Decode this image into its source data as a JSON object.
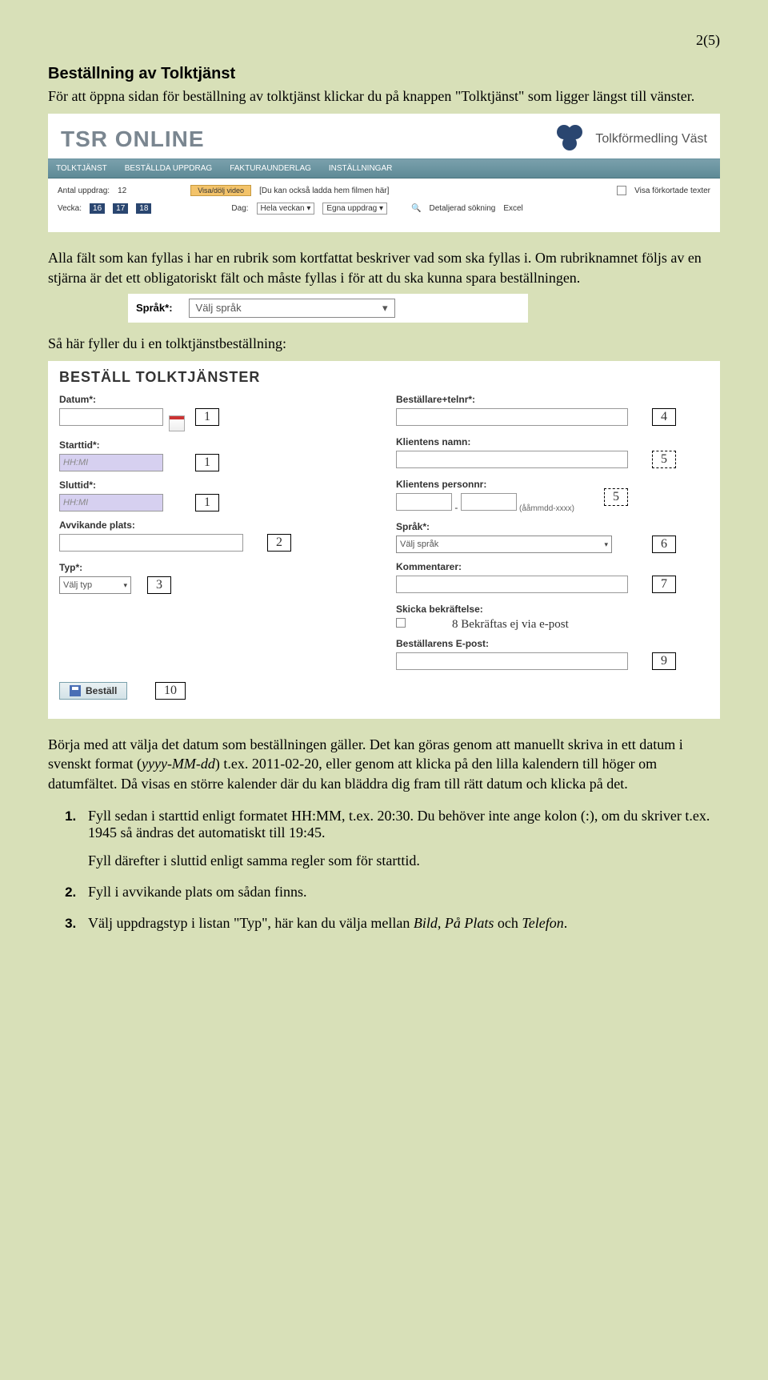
{
  "page_number": "2(5)",
  "heading": "Beställning av Tolktjänst",
  "intro": "För att öppna sidan för beställning av tolktjänst klickar du på knappen \"Tolktjänst\" som ligger längst till vänster.",
  "tsr": {
    "title": "TSR ONLINE",
    "logo_text": "Tolkförmedling Väst",
    "nav": [
      "TOLKTJÄNST",
      "BESTÄLLDA UPPDRAG",
      "FAKTURAUNDERLAG",
      "INSTÄLLNINGAR"
    ],
    "row1": {
      "antal_label": "Antal uppdrag:",
      "antal_val": "12",
      "visa_dolj": "Visa/dölj video",
      "film_text": "[Du kan också ladda hem filmen här]",
      "forkortade": "Visa förkortade texter"
    },
    "row2": {
      "vecka": "Vecka:",
      "days": [
        "16",
        "17",
        "18"
      ],
      "dag": "Dag:",
      "hela_veckan": "Hela veckan",
      "egna": "Egna uppdrag",
      "detaljerad": "Detaljerad sökning",
      "excel": "Excel"
    }
  },
  "para_rubrik": "Alla fält som kan fyllas i har en rubrik som kortfattat beskriver vad som ska fyllas i. Om rubriknamnet följs av en stjärna är det ett obligatoriskt fält och måste fyllas i för att du ska kunna spara beställningen.",
  "sprak": {
    "label": "Språk*:",
    "value": "Välj språk"
  },
  "sa_har": "Så här fyller du i en tolktjänstbeställning:",
  "form": {
    "title": "BESTÄLL TOLKTJÄNSTER",
    "datum": "Datum*:",
    "starttid": "Starttid*:",
    "sluttid": "Sluttid*:",
    "hhmi": "HH:MI",
    "avvikande": "Avvikande plats:",
    "typ": "Typ*:",
    "valj_typ": "Välj typ",
    "bestallare": "Beställare+telnr*:",
    "klient_namn": "Klientens namn:",
    "klient_pnr": "Klientens personnr:",
    "pnr_hint": "(ååmmdd-xxxx)",
    "sprak": "Språk*:",
    "valj_sprak": "Välj språk",
    "kommentarer": "Kommentarer:",
    "skicka": "Skicka bekräftelse:",
    "epost_label": "Beställarens E-post:",
    "bestall_btn": "Beställ"
  },
  "annotations": {
    "n1": "1",
    "n2": "2",
    "n3": "3",
    "n4": "4",
    "n5": "5",
    "n6": "6",
    "n7": "7",
    "n8": "8 Bekräftas ej via e-post",
    "n9": "9",
    "n10": "10"
  },
  "para_borja": "Börja med att välja det datum som beställningen gäller. Det kan göras genom att manuellt skriva in ett datum i svenskt format (",
  "para_borja_fmt": "yyyy-MM-dd",
  "para_borja2": ") t.ex. 2011-02-20, eller genom att klicka på den lilla kalendern till höger om datumfältet. Då visas en större kalender där du kan bläddra dig fram till rätt datum och klicka på det.",
  "steps": {
    "s1a": "Fyll sedan i starttid enligt formatet HH:MM, t.ex. 20:30. Du behöver inte ange kolon (:), om du skriver t.ex. 1945 så ändras det automatiskt till 19:45.",
    "s1b": "Fyll därefter i sluttid enligt samma regler som för starttid.",
    "s2": "Fyll i avvikande plats om sådan finns.",
    "s3a": "Välj uppdragstyp i listan \"Typ\", här kan du välja mellan ",
    "s3b": "Bild",
    "s3c": ", ",
    "s3d": "På Plats",
    "s3e": " och ",
    "s3f": "Telefon",
    "s3g": "."
  }
}
